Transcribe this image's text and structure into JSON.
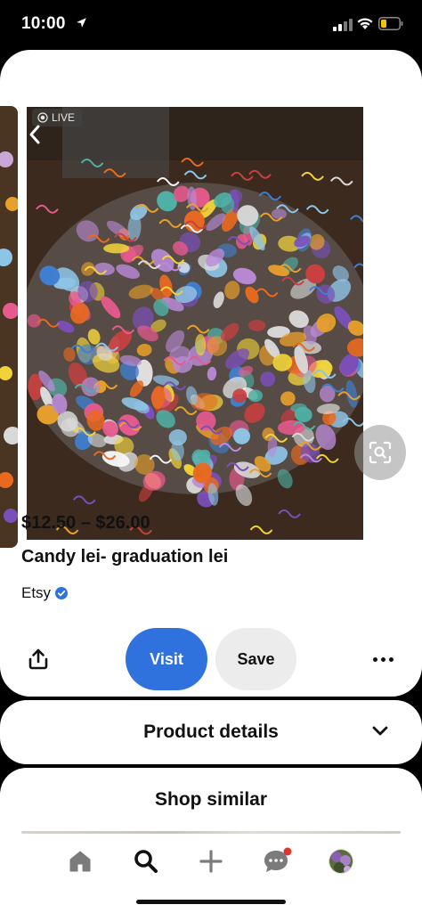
{
  "status_bar": {
    "time": "10:00",
    "icons": [
      "location-arrow-icon",
      "cellular-signal-icon",
      "wifi-icon",
      "battery-icon"
    ]
  },
  "pin": {
    "live_label": "LIVE",
    "price": "$12.50 – $26.00",
    "title": "Candy lei- graduation lei",
    "seller": "Etsy",
    "image_description_icon": "candy-lei-photo"
  },
  "actions": {
    "visit_label": "Visit",
    "save_label": "Save"
  },
  "sections": {
    "product_details": "Product details",
    "shop_similar": "Shop similar"
  },
  "nav": {
    "items": [
      "home-icon",
      "search-icon",
      "create-plus-icon",
      "messages-icon",
      "profile-avatar"
    ]
  },
  "colors": {
    "visit_button": "#2f72dd",
    "save_button": "#ececec",
    "notification_dot": "#e0342f",
    "verified_badge": "#2f72dd"
  }
}
